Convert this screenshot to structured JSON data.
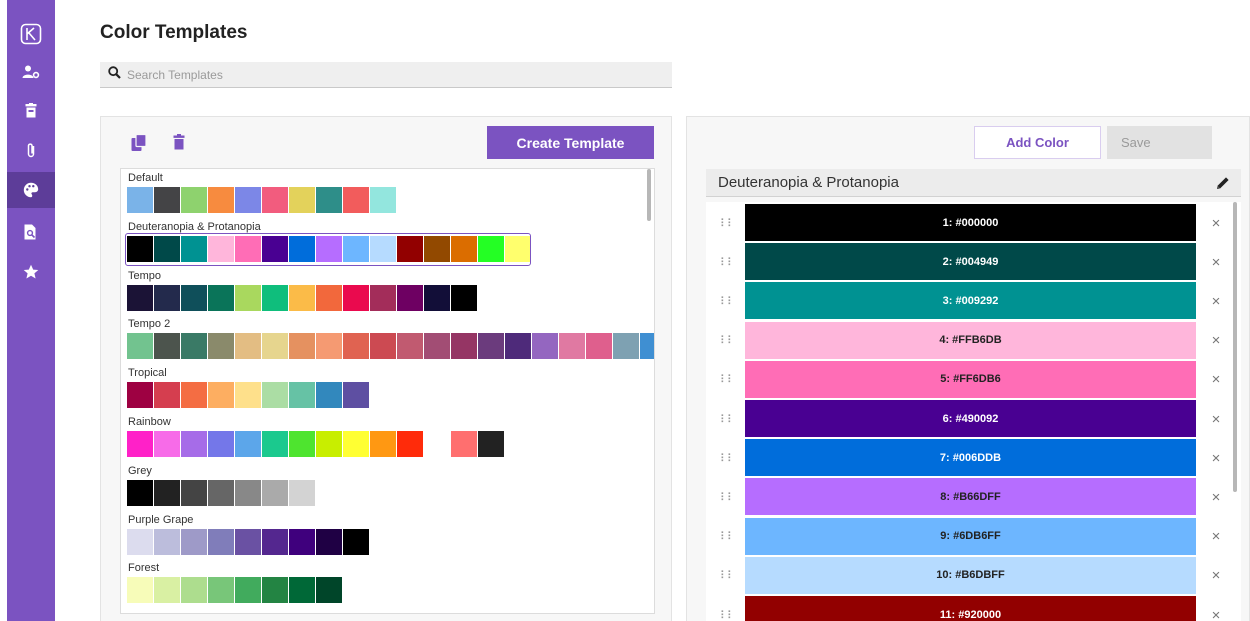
{
  "header": {
    "title": "Color Templates",
    "search_placeholder": "Search Templates"
  },
  "left_panel": {
    "create_label": "Create Template",
    "templates": [
      {
        "name": "Default",
        "colors": [
          "#7AB3E8",
          "#444446",
          "#8ED26E",
          "#F78B3F",
          "#7C87E7",
          "#F25C7E",
          "#E3D25B",
          "#2E8E89",
          "#F25C5C",
          "#93E6DE"
        ]
      },
      {
        "name": "Deuteranopia & Protanopia",
        "selected": true,
        "colors": [
          "#000000",
          "#004949",
          "#009292",
          "#FFB6DB",
          "#FF6DB6",
          "#490092",
          "#006DDB",
          "#B66DFF",
          "#6DB6FF",
          "#B6DBFF",
          "#920000",
          "#924900",
          "#DB6D00",
          "#24FF24",
          "#FFFF6D"
        ]
      },
      {
        "name": "Tempo",
        "colors": [
          "#1B1336",
          "#232A4C",
          "#0F4F5A",
          "#0A7459",
          "#A9D85E",
          "#0FBE7C",
          "#FBBB48",
          "#F2683C",
          "#EA0A4E",
          "#A32D5A",
          "#6E0062",
          "#120E38",
          "#000000"
        ]
      },
      {
        "name": "Tempo 2",
        "colors": [
          "#72C38F",
          "#4C544D",
          "#3A7A66",
          "#8A8A6B",
          "#E3BD83",
          "#E6D58E",
          "#E59160",
          "#F59A72",
          "#E06351",
          "#CC4A52",
          "#C15A70",
          "#A24D74",
          "#953564",
          "#6B3B7D",
          "#4E2A7A",
          "#9466C0",
          "#E079A2",
          "#DF5F8D",
          "#7EA1B2",
          "#3F8FD2"
        ]
      },
      {
        "name": "Tropical",
        "colors": [
          "#9E0142",
          "#D53E4F",
          "#F46D43",
          "#FDAE61",
          "#FEE08B",
          "#ABDDA4",
          "#66C2A5",
          "#3288BD",
          "#5E4FA2"
        ]
      },
      {
        "name": "Rainbow",
        "colors": [
          "#FF21C8",
          "#F76BE8",
          "#A66CE8",
          "#7477E9",
          "#5CA6EA",
          "#1BC98E",
          "#4EE42F",
          "#C8EE00",
          "#FFFF33",
          "#FF9812",
          "#FF2B0A",
          "#FFFFFF",
          "#FF6F6F",
          "#222222"
        ]
      },
      {
        "name": "Grey",
        "colors": [
          "#000000",
          "#222222",
          "#444444",
          "#666666",
          "#888888",
          "#AAAAAA",
          "#D3D3D3"
        ]
      },
      {
        "name": "Purple Grape",
        "colors": [
          "#DCDCEE",
          "#BCBDDC",
          "#9E9AC8",
          "#807DBA",
          "#6A51A3",
          "#54278F",
          "#3F007D",
          "#1F0044",
          "#000000"
        ]
      },
      {
        "name": "Forest",
        "colors": [
          "#F7FCB9",
          "#D9F0A3",
          "#ADDD8E",
          "#78C679",
          "#41AB5D",
          "#238443",
          "#006837",
          "#004529"
        ]
      }
    ]
  },
  "right_panel": {
    "add_label": "Add Color",
    "save_label": "Save",
    "template_name": "Deuteranopia & Protanopia",
    "colors": [
      {
        "label": "1: #000000",
        "hex": "#000000",
        "text": "#ffffff"
      },
      {
        "label": "2: #004949",
        "hex": "#004949",
        "text": "#ffffff"
      },
      {
        "label": "3: #009292",
        "hex": "#009292",
        "text": "#ffffff"
      },
      {
        "label": "4: #FFB6DB",
        "hex": "#FFB6DB",
        "text": "#222222"
      },
      {
        "label": "5: #FF6DB6",
        "hex": "#FF6DB6",
        "text": "#222222"
      },
      {
        "label": "6: #490092",
        "hex": "#490092",
        "text": "#ffffff"
      },
      {
        "label": "7: #006DDB",
        "hex": "#006DDB",
        "text": "#ffffff"
      },
      {
        "label": "8: #B66DFF",
        "hex": "#B66DFF",
        "text": "#222222"
      },
      {
        "label": "9: #6DB6FF",
        "hex": "#6DB6FF",
        "text": "#222222"
      },
      {
        "label": "10: #B6DBFF",
        "hex": "#B6DBFF",
        "text": "#222222"
      },
      {
        "label": "11: #920000",
        "hex": "#920000",
        "text": "#ffffff"
      }
    ]
  },
  "sidebar": {
    "icons": [
      "logo-icon",
      "user-settings-icon",
      "trash-can-icon",
      "paperclip-icon",
      "palette-icon",
      "document-search-icon",
      "star-icon"
    ]
  },
  "theme": {
    "accent": "#7B53C1",
    "accent_dark": "#5D3D99"
  }
}
